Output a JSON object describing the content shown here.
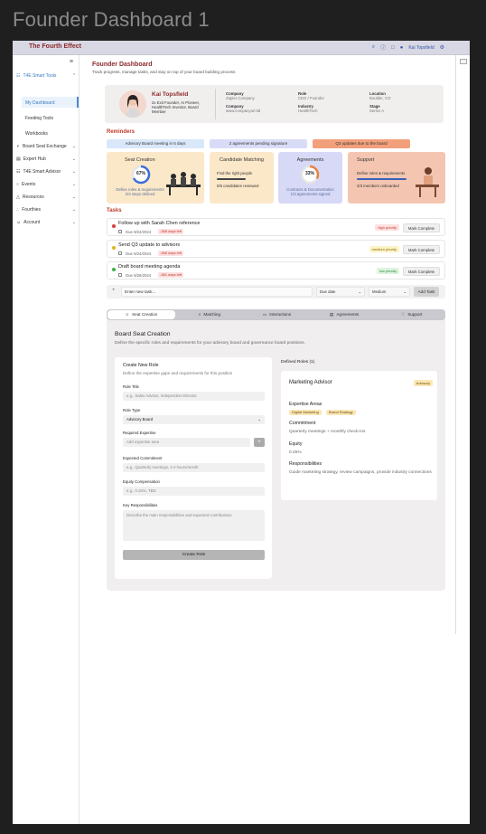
{
  "outer_title": "Founder Dashboard 1",
  "topbar": {
    "brand": "The Fourth Effect",
    "user": "Kai Topsfield"
  },
  "sidebar": {
    "groups": [
      {
        "label": "T4E Smart Tools",
        "children": [
          "My Dashboard",
          "Feeding Tools",
          "Workbooks"
        ]
      },
      {
        "label": "Board Seat Exchange"
      },
      {
        "label": "Expert Hub"
      },
      {
        "label": "T4E Smart Advisor"
      },
      {
        "label": "Events"
      },
      {
        "label": "Resources"
      },
      {
        "label": "Fourthies"
      },
      {
        "label": "Account"
      }
    ],
    "active": "My Dashboard"
  },
  "header": {
    "title": "Founder Dashboard",
    "subtitle": "Track progress, manage tasks, and stay on top of your board building process"
  },
  "profile": {
    "name": "Kai Topsfield",
    "desc": "2x Exit Founder, AI Pioneer, HealthTech Investor, Board Member",
    "fields": [
      {
        "label": "Company",
        "value": "Zapier Company"
      },
      {
        "label": "Role",
        "value": "CEO / Founder"
      },
      {
        "label": "Location",
        "value": "Boulder, CO"
      },
      {
        "label": "Company",
        "value": "www.companyurl.ltd"
      },
      {
        "label": "Industry",
        "value": "HealthTech"
      },
      {
        "label": "Stage",
        "value": "Series A"
      }
    ]
  },
  "reminders": {
    "title": "Reminders",
    "items": [
      "Advisory Board meeting in 5 days",
      "2 agreements pending signature",
      "Q3 updates due to the board"
    ]
  },
  "cards": [
    {
      "title": "Seat Creation",
      "pct": "67%",
      "desc": "Define roles & requirements\n2/3 steps defined"
    },
    {
      "title": "Candidate Matching",
      "line1": "Find the right people",
      "line2": "0/6 candidates reviewed"
    },
    {
      "title": "Agreements",
      "pct": "33%",
      "desc": "Contracts & Documentation\n1/3 agreements signed"
    },
    {
      "title": "Support",
      "line1": "Define roles & requirements",
      "line2": "2/3 members onboarded"
    }
  ],
  "tasks": {
    "title": "Tasks",
    "items": [
      {
        "title": "Follow up with Sarah Chen reference",
        "due": "Due 9/22/2024",
        "late": "-368 days left",
        "priority": "high priority",
        "action": "Mark Complete"
      },
      {
        "title": "Send Q3 update to advisors",
        "due": "Due 9/24/2024",
        "late": "-366 days left",
        "priority": "medium priority",
        "action": "Mark Complete"
      },
      {
        "title": "Draft board meeting agenda",
        "due": "Due 9/28/2024",
        "late": "-361 days left",
        "priority": "low priority",
        "action": "Mark Complete"
      }
    ],
    "new_placeholder": "Enter new task...",
    "due_select": "Due date",
    "priority_select": "Medium",
    "add_label": "Add Task"
  },
  "tabs": [
    "Seat Creation",
    "Matching",
    "Interactions",
    "Agreements",
    "Support"
  ],
  "board_seat": {
    "title": "Board Seat Creation",
    "subtitle": "Define the specific roles and requirements for your advisory board and governance board positions.",
    "form": {
      "heading": "Create New Role",
      "sub": "Define the expertise gaps and requirements for this position",
      "role_title_label": "Role Title",
      "role_title_ph": "e.g., Sales Advisor, Independent Director",
      "role_type_label": "Role Type",
      "role_type_value": "Advisory Board",
      "expertise_label": "Required Expertise",
      "expertise_ph": "Add expertise area",
      "commitment_label": "Expected Commitment",
      "commitment_ph": "e.g., Quarterly meetings, 2-4 hours/month",
      "equity_label": "Equity Compensation",
      "equity_ph": "e.g., 0.25%, TBD",
      "resp_label": "Key Responsibilities",
      "resp_ph": "Describe the main responsibilities and expected contributions",
      "button": "Create Role"
    },
    "defined_title": "Defined Roles (1)",
    "role": {
      "title": "Marketing Advisor",
      "badge": "Advisory",
      "expertise_label": "Expertise Areas",
      "chips": [
        "Digital Marketing",
        "Brand Strategy"
      ],
      "commitment_label": "Commitment",
      "commitment": "Quarterly meetings + monthly check-ins",
      "equity_label": "Equity",
      "equity": "0.25%",
      "resp_label": "Responsibilities",
      "resp": "Guide marketing strategy, review campaigns, provide industry connections"
    }
  }
}
